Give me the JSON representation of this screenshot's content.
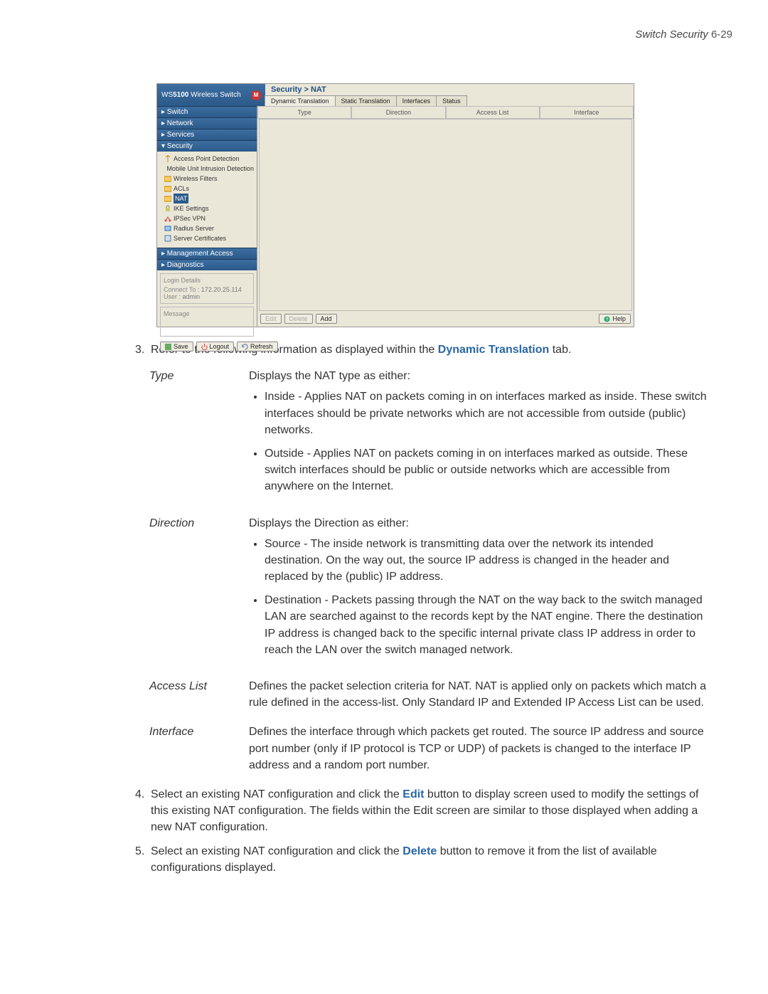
{
  "header": {
    "title_italic": "Switch Security",
    "title_page": "  6-29"
  },
  "screenshot": {
    "brand_prefix": "WS",
    "brand_bold": "5100",
    "brand_suffix": " Wireless Switch",
    "brand_badge": "M",
    "breadcrumb": "Security > NAT",
    "tabs": [
      "Dynamic Translation",
      "Static Translation",
      "Interfaces",
      "Status"
    ],
    "sections": [
      "▸ Switch",
      "▸ Network",
      "▸ Services",
      "▾ Security"
    ],
    "tree": [
      "Access Point Detection",
      "Mobile Unit Intrusion Detection",
      "Wireless Filters",
      "ACLs",
      "NAT",
      "IKE Settings",
      "IPSec VPN",
      "Radius Server",
      "Server Certificates"
    ],
    "sections_after": [
      "▸ Management Access",
      "▸ Diagnostics"
    ],
    "login": {
      "title": "Login Details",
      "connect_lbl": "Connect To :",
      "connect_val": "172.20.25.114",
      "user_lbl": "User :",
      "user_val": "admin"
    },
    "message_title": "Message",
    "left_buttons": [
      "Save",
      "Logout",
      "Refresh"
    ],
    "table_headers": [
      "Type",
      "Direction",
      "Access List",
      "Interface"
    ],
    "main_buttons_left": [
      "Edit",
      "Delete",
      "Add"
    ],
    "main_button_right": "Help"
  },
  "step3": {
    "num": "3.",
    "pre": "Refer to the following information as displayed within the ",
    "link": "Dynamic Translation",
    "post": " tab."
  },
  "defs": {
    "type": {
      "term": "Type",
      "lead": "Displays the NAT type as either:",
      "b1": "Inside - Applies NAT on packets coming in on interfaces marked as inside. These switch interfaces should be private networks which are not accessible from outside (public) networks.",
      "b2": "Outside - Applies NAT on packets coming in on interfaces marked as outside. These switch interfaces should be public or outside networks which are accessible from anywhere on the Internet."
    },
    "direction": {
      "term": "Direction",
      "lead": "Displays the Direction as either:",
      "b1": "Source - The inside network is transmitting data over the network its intended destination. On the way out, the source IP address is changed in the header and replaced by the (public) IP address.",
      "b2": "Destination - Packets passing through the NAT on the way back to the switch managed LAN are searched against to the records kept by the NAT engine. There the destination IP address is changed back to the specific internal private class IP address in order to reach the LAN over the switch managed network."
    },
    "access": {
      "term": "Access List",
      "text": "Defines the packet selection criteria for NAT. NAT is applied only on packets which match a rule defined in the access-list. Only Standard IP and Extended IP Access List can be used."
    },
    "iface": {
      "term": "Interface",
      "text": "Defines the interface through which packets get routed. The source IP address and source port number (only if IP protocol is TCP or UDP) of packets is changed to the interface IP address and a random port number."
    }
  },
  "step4": {
    "num": "4.",
    "pre": "Select an existing NAT configuration and click the ",
    "link": "Edit",
    "post": " button to display screen used to modify the settings of this existing NAT configuration. The fields within the Edit screen are similar to those displayed when adding a new NAT configuration."
  },
  "step5": {
    "num": "5.",
    "pre": "Select an existing NAT configuration and click the ",
    "link": "Delete",
    "post": " button to remove it from the list of available configurations displayed."
  }
}
